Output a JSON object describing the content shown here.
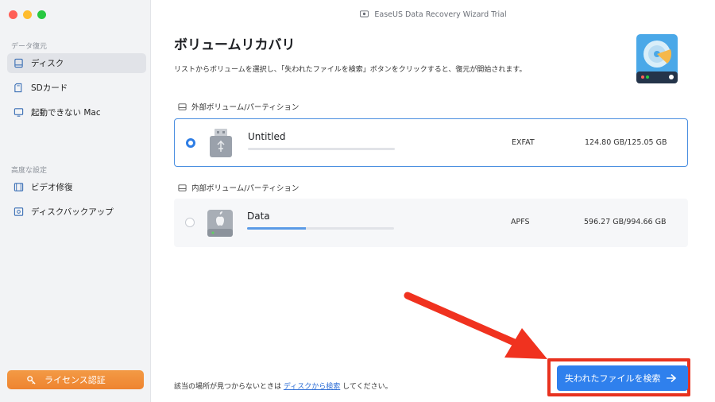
{
  "window": {
    "title": "EaseUS Data Recovery Wizard  Trial"
  },
  "sidebar": {
    "section1_label": "データ復元",
    "items": [
      {
        "label": "ディスク",
        "icon": "disk-icon",
        "active": true
      },
      {
        "label": "SDカード",
        "icon": "sd-card-icon",
        "active": false
      },
      {
        "label": "起動できない Mac",
        "icon": "monitor-icon",
        "active": false
      }
    ],
    "section2_label": "高度な設定",
    "advanced_items": [
      {
        "label": "ビデオ修復",
        "icon": "video-icon"
      },
      {
        "label": "ディスクバックアップ",
        "icon": "backup-icon"
      }
    ],
    "license_button": "ライセンス認証"
  },
  "main": {
    "title": "ボリュームリカバリ",
    "description": "リストからボリュームを選択し、「失われたファイルを検索」ボタンをクリックすると、復元が開始されます。",
    "external_group": "外部ボリューム/パーティション",
    "internal_group": "内部ボリューム/パーティション",
    "volumes": [
      {
        "name": "Untitled",
        "fs": "EXFAT",
        "size": "124.80 GB/125.05 GB",
        "used_fraction": 0.0,
        "selected": true
      },
      {
        "name": "Data",
        "fs": "APFS",
        "size": "596.27 GB/994.66 GB",
        "used_fraction": 0.4,
        "selected": false
      }
    ],
    "footer_prefix": "該当の場所が見つからないときは",
    "footer_link": "ディスクから検索",
    "footer_suffix": "してください。",
    "search_button": "失われたファイルを検索"
  },
  "colors": {
    "accent": "#2f80ed",
    "highlight": "#e8321f",
    "license": "#ef8a36"
  }
}
